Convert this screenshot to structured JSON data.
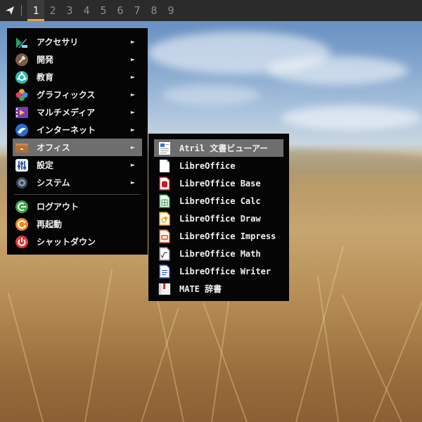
{
  "panel": {
    "workspaces": [
      "1",
      "2",
      "3",
      "4",
      "5",
      "6",
      "7",
      "8",
      "9"
    ],
    "active_workspace": "1"
  },
  "main_menu": {
    "items": [
      {
        "label": "アクセサリ",
        "icon": "accessories-icon",
        "submenu": true
      },
      {
        "label": "開発",
        "icon": "development-icon",
        "submenu": true
      },
      {
        "label": "教育",
        "icon": "education-icon",
        "submenu": true
      },
      {
        "label": "グラフィックス",
        "icon": "graphics-icon",
        "submenu": true
      },
      {
        "label": "マルチメディア",
        "icon": "multimedia-icon",
        "submenu": true
      },
      {
        "label": "インターネット",
        "icon": "internet-icon",
        "submenu": true
      },
      {
        "label": "オフィス",
        "icon": "office-icon",
        "submenu": true,
        "selected": true
      },
      {
        "label": "設定",
        "icon": "settings-icon",
        "submenu": true
      },
      {
        "label": "システム",
        "icon": "system-icon",
        "submenu": true
      }
    ],
    "session": [
      {
        "label": "ログアウト",
        "icon": "logout-icon"
      },
      {
        "label": "再起動",
        "icon": "reboot-icon"
      },
      {
        "label": "シャットダウン",
        "icon": "shutdown-icon"
      }
    ],
    "submenu_arrow": "►"
  },
  "office_menu": {
    "items": [
      {
        "label": "Atril 文書ビューアー",
        "icon": "document-viewer-icon",
        "selected": true
      },
      {
        "label": "LibreOffice",
        "icon": "libreoffice-icon"
      },
      {
        "label": "LibreOffice Base",
        "icon": "libreoffice-base-icon"
      },
      {
        "label": "LibreOffice Calc",
        "icon": "libreoffice-calc-icon"
      },
      {
        "label": "LibreOffice Draw",
        "icon": "libreoffice-draw-icon"
      },
      {
        "label": "LibreOffice Impress",
        "icon": "libreoffice-impress-icon"
      },
      {
        "label": "LibreOffice Math",
        "icon": "libreoffice-math-icon"
      },
      {
        "label": "LibreOffice Writer",
        "icon": "libreoffice-writer-icon"
      },
      {
        "label": "MATE 辞書",
        "icon": "dictionary-icon"
      }
    ]
  }
}
